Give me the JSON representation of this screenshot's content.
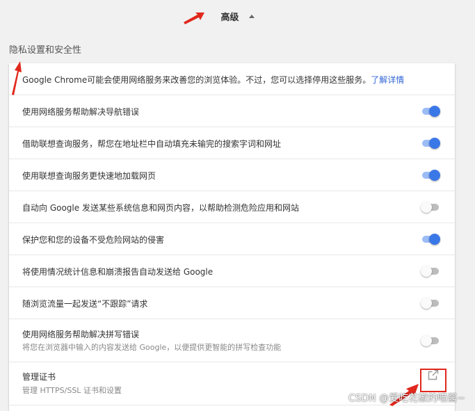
{
  "header": {
    "advanced_label": "高级"
  },
  "section": {
    "title": "隐私设置和安全性"
  },
  "intro": {
    "text": "Google Chrome可能会使用网络服务来改善您的浏览体验。不过，您可以选择停用这些服务。",
    "link": "了解详情"
  },
  "settings": [
    {
      "label": "使用网络服务帮助解决导航错误",
      "enabled": true
    },
    {
      "label": "借助联想查询服务，帮您在地址栏中自动填充未输完的搜索字词和网址",
      "enabled": true
    },
    {
      "label": "使用联想查询服务更快速地加载网页",
      "enabled": true
    },
    {
      "label": "自动向 Google 发送某些系统信息和网页内容，以帮助检测危险应用和网站",
      "enabled": false
    },
    {
      "label": "保护您和您的设备不受危险网站的侵害",
      "enabled": true
    },
    {
      "label": "将使用情况统计信息和崩溃报告自动发送给 Google",
      "enabled": false
    },
    {
      "label": "随浏览流量一起发送“不跟踪”请求",
      "enabled": false
    },
    {
      "label": "使用网络服务帮助解决拼写错误",
      "sublabel": "将您在浏览器中输入的内容发送给 Google，以便提供更智能的拼写检查功能",
      "enabled": false
    }
  ],
  "certificates": {
    "title": "管理证书",
    "subtitle": "管理 HTTPS/SSL 证书和设置",
    "icon": "open-in-new-icon"
  },
  "watermark": "CSDN @爱吃花椒的喵酱~",
  "colors": {
    "toggle_on_knob": "#3b78e7",
    "toggle_on_track": "#9cbcf5",
    "toggle_off_knob": "#fafafa",
    "toggle_off_track": "#bdbdbd",
    "link": "#3367d6",
    "annotation_red": "#e0281d"
  }
}
